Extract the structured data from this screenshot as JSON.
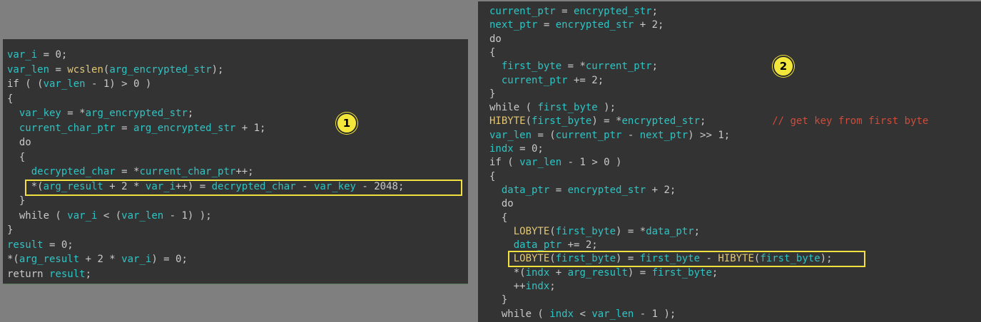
{
  "panels": [
    {
      "badge": "1",
      "lines": [
        [
          [
            "cyan",
            "var_i"
          ],
          [
            "white",
            " = 0;"
          ]
        ],
        [
          [
            "cyan",
            "var_len"
          ],
          [
            "white",
            " = "
          ],
          [
            "yellow",
            "wcslen"
          ],
          [
            "white",
            "("
          ],
          [
            "cyan",
            "arg_encrypted_str"
          ],
          [
            "white",
            ");"
          ]
        ],
        [
          [
            "white",
            "if ( ("
          ],
          [
            "cyan",
            "var_len"
          ],
          [
            "white",
            " - 1) > 0 )"
          ]
        ],
        [
          [
            "white",
            "{"
          ]
        ],
        [
          [
            "white",
            "  "
          ],
          [
            "cyan",
            "var_key"
          ],
          [
            "white",
            " = *"
          ],
          [
            "cyan",
            "arg_encrypted_str"
          ],
          [
            "white",
            ";"
          ]
        ],
        [
          [
            "white",
            "  "
          ],
          [
            "cyan",
            "current_char_ptr"
          ],
          [
            "white",
            " = "
          ],
          [
            "cyan",
            "arg_encrypted_str"
          ],
          [
            "white",
            " + 1;"
          ]
        ],
        [
          [
            "white",
            "  do"
          ]
        ],
        [
          [
            "white",
            "  {"
          ]
        ],
        [
          [
            "white",
            "    "
          ],
          [
            "cyan",
            "decrypted_char"
          ],
          [
            "white",
            " = *"
          ],
          [
            "cyan",
            "current_char_ptr"
          ],
          [
            "white",
            "++;"
          ]
        ],
        [
          [
            "white",
            "    *("
          ],
          [
            "cyan",
            "arg_result"
          ],
          [
            "white",
            " + 2 * "
          ],
          [
            "cyan",
            "var_i"
          ],
          [
            "white",
            "++) = "
          ],
          [
            "cyan",
            "decrypted_char"
          ],
          [
            "white",
            " - "
          ],
          [
            "cyan",
            "var_key"
          ],
          [
            "white",
            " - 2048;"
          ]
        ],
        [
          [
            "white",
            "  }"
          ]
        ],
        [
          [
            "white",
            "  while ( "
          ],
          [
            "cyan",
            "var_i"
          ],
          [
            "white",
            " < ("
          ],
          [
            "cyan",
            "var_len"
          ],
          [
            "white",
            " - 1) );"
          ]
        ],
        [
          [
            "white",
            "}"
          ]
        ],
        [
          [
            "cyan",
            "result"
          ],
          [
            "white",
            " = 0;"
          ]
        ],
        [
          [
            "white",
            "*("
          ],
          [
            "cyan",
            "arg_result"
          ],
          [
            "white",
            " + 2 * "
          ],
          [
            "cyan",
            "var_i"
          ],
          [
            "white",
            ") = 0;"
          ]
        ],
        [
          [
            "white",
            "return "
          ],
          [
            "cyan",
            "result"
          ],
          [
            "white",
            ";"
          ]
        ]
      ]
    },
    {
      "badge": "2",
      "lines": [
        [
          [
            "cyan",
            "current_ptr"
          ],
          [
            "white",
            " = "
          ],
          [
            "cyan",
            "encrypted_str"
          ],
          [
            "white",
            ";"
          ]
        ],
        [
          [
            "cyan",
            "next_ptr"
          ],
          [
            "white",
            " = "
          ],
          [
            "cyan",
            "encrypted_str"
          ],
          [
            "white",
            " + 2;"
          ]
        ],
        [
          [
            "white",
            "do"
          ]
        ],
        [
          [
            "white",
            "{"
          ]
        ],
        [
          [
            "white",
            "  "
          ],
          [
            "cyan",
            "first_byte"
          ],
          [
            "white",
            " = *"
          ],
          [
            "cyan",
            "current_ptr"
          ],
          [
            "white",
            ";"
          ]
        ],
        [
          [
            "white",
            "  "
          ],
          [
            "cyan",
            "current_ptr"
          ],
          [
            "white",
            " += 2;"
          ]
        ],
        [
          [
            "white",
            "}"
          ]
        ],
        [
          [
            "white",
            "while ( "
          ],
          [
            "cyan",
            "first_byte"
          ],
          [
            "white",
            " );"
          ]
        ],
        [
          [
            "yellow",
            "HIBYTE"
          ],
          [
            "white",
            "("
          ],
          [
            "cyan",
            "first_byte"
          ],
          [
            "white",
            ") = *"
          ],
          [
            "cyan",
            "encrypted_str"
          ],
          [
            "white",
            ";           "
          ],
          [
            "comment",
            "// get key from first byte"
          ]
        ],
        [
          [
            "cyan",
            "var_len"
          ],
          [
            "white",
            " = ("
          ],
          [
            "cyan",
            "current_ptr"
          ],
          [
            "white",
            " - "
          ],
          [
            "cyan",
            "next_ptr"
          ],
          [
            "white",
            ") >> 1;"
          ]
        ],
        [
          [
            "cyan",
            "indx"
          ],
          [
            "white",
            " = 0;"
          ]
        ],
        [
          [
            "white",
            "if ( "
          ],
          [
            "cyan",
            "var_len"
          ],
          [
            "white",
            " - 1 > 0 )"
          ]
        ],
        [
          [
            "white",
            "{"
          ]
        ],
        [
          [
            "white",
            "  "
          ],
          [
            "cyan",
            "data_ptr"
          ],
          [
            "white",
            " = "
          ],
          [
            "cyan",
            "encrypted_str"
          ],
          [
            "white",
            " + 2;"
          ]
        ],
        [
          [
            "white",
            "  do"
          ]
        ],
        [
          [
            "white",
            "  {"
          ]
        ],
        [
          [
            "white",
            "    "
          ],
          [
            "yellow",
            "LOBYTE"
          ],
          [
            "white",
            "("
          ],
          [
            "cyan",
            "first_byte"
          ],
          [
            "white",
            ") = *"
          ],
          [
            "cyan",
            "data_ptr"
          ],
          [
            "white",
            ";"
          ]
        ],
        [
          [
            "white",
            "    "
          ],
          [
            "cyan",
            "data_ptr"
          ],
          [
            "white",
            " += 2;"
          ]
        ],
        [
          [
            "white",
            "    "
          ],
          [
            "yellow",
            "LOBYTE"
          ],
          [
            "white",
            "("
          ],
          [
            "cyan",
            "first_byte"
          ],
          [
            "white",
            ") = "
          ],
          [
            "cyan",
            "first_byte"
          ],
          [
            "white",
            " - "
          ],
          [
            "yellow",
            "HIBYTE"
          ],
          [
            "white",
            "("
          ],
          [
            "cyan",
            "first_byte"
          ],
          [
            "white",
            ");"
          ]
        ],
        [
          [
            "white",
            "    *("
          ],
          [
            "cyan",
            "indx"
          ],
          [
            "white",
            " + "
          ],
          [
            "cyan",
            "arg_result"
          ],
          [
            "white",
            ") = "
          ],
          [
            "cyan",
            "first_byte"
          ],
          [
            "white",
            ";"
          ]
        ],
        [
          [
            "white",
            "    ++"
          ],
          [
            "cyan",
            "indx"
          ],
          [
            "white",
            ";"
          ]
        ],
        [
          [
            "white",
            "  }"
          ]
        ],
        [
          [
            "white",
            "  while ( "
          ],
          [
            "cyan",
            "indx"
          ],
          [
            "white",
            " < "
          ],
          [
            "cyan",
            "var_len"
          ],
          [
            "white",
            " - 1 );"
          ]
        ]
      ]
    }
  ]
}
